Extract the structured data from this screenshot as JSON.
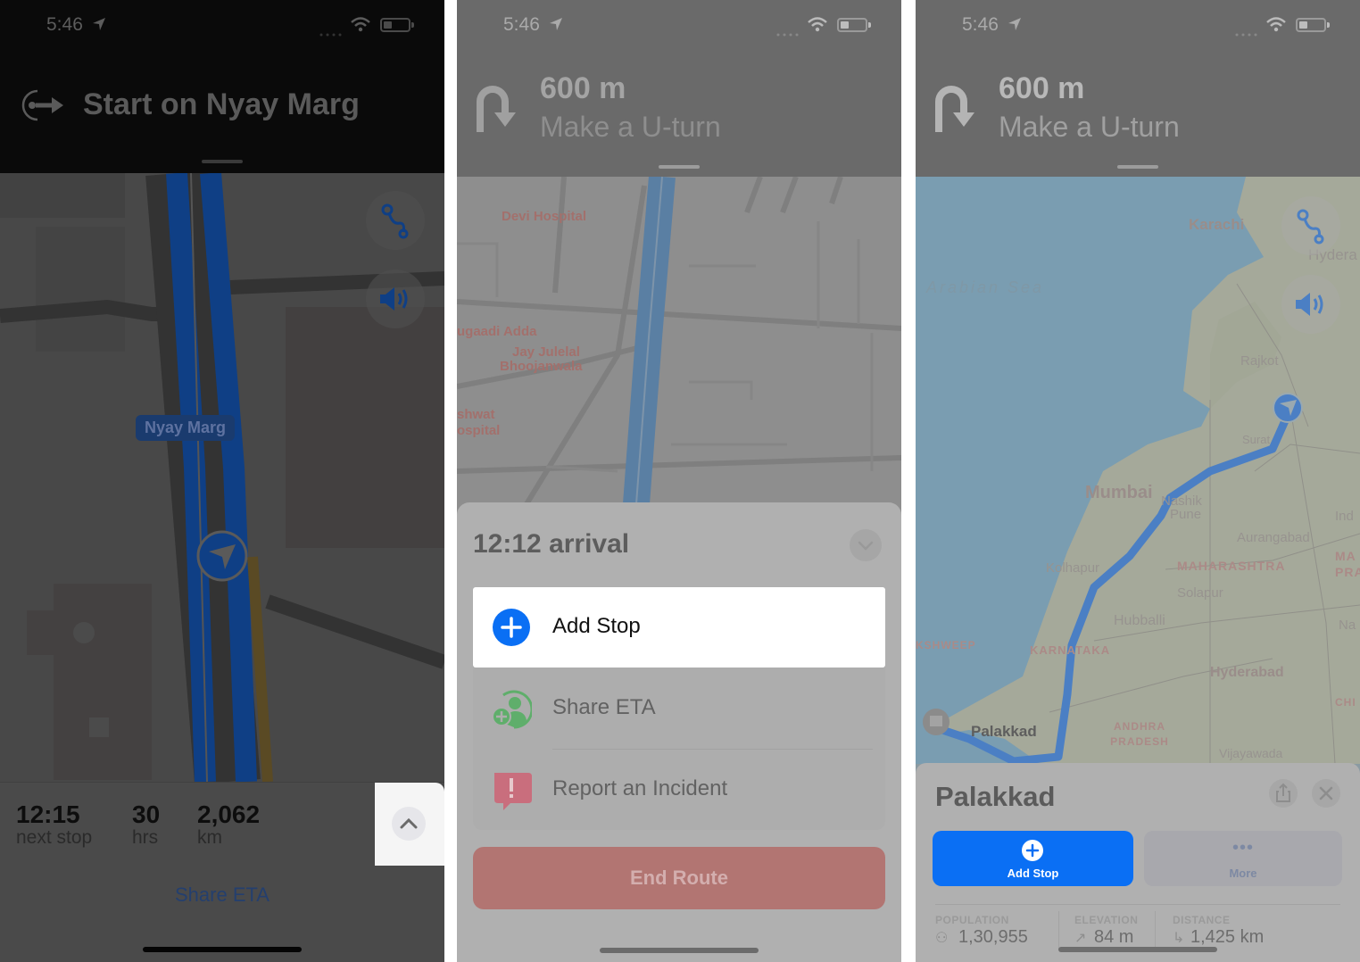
{
  "panels": [
    {
      "status_bar": {
        "time": "5:46"
      },
      "nav_banner": {
        "instruction": "Start on Nyay Marg",
        "icon": "start-route-icon"
      },
      "map": {
        "road_label": "Nyay Marg",
        "buttons": [
          {
            "icon": "route-options-icon"
          },
          {
            "icon": "speaker-volume-icon"
          }
        ]
      },
      "trip_bar": {
        "stats": [
          {
            "value": "12:15",
            "label": "next stop"
          },
          {
            "value": "30",
            "label": "hrs"
          },
          {
            "value": "2,062",
            "label": "km"
          }
        ],
        "expand_icon": "chevron-up-icon",
        "share_eta": "Share ETA"
      }
    },
    {
      "status_bar": {
        "time": "5:46"
      },
      "nav_banner": {
        "distance": "600 m",
        "instruction": "Make a U-turn",
        "icon": "u-turn-icon"
      },
      "map": {
        "pois": [
          "Devi Hospital",
          "ugaadi Adda",
          "Jay Julelal",
          "Bhoojanwala",
          "shwat",
          "ospital"
        ]
      },
      "sheet": {
        "arrival": "12:12 arrival",
        "collapse_icon": "chevron-down-icon",
        "menu": [
          {
            "label": "Add Stop",
            "icon": "add-stop-icon",
            "highlighted": true
          },
          {
            "label": "Share ETA",
            "icon": "share-eta-icon"
          },
          {
            "label": "Report an Incident",
            "icon": "report-incident-icon"
          }
        ],
        "end_route": "End Route"
      }
    },
    {
      "status_bar": {
        "time": "5:46"
      },
      "nav_banner": {
        "distance": "600 m",
        "instruction": "Make a U-turn",
        "icon": "u-turn-icon"
      },
      "map": {
        "labels": {
          "sea": "Arabian Sea",
          "karachi": "Karachi",
          "hyderabad_pk": "Hydera",
          "rajkot": "Rajkot",
          "surat": "Surat",
          "mumbai": "Mumbai",
          "nashik": "Nashik",
          "pune": "Pune",
          "aurangabad": "Aurangabad",
          "ind": "Ind",
          "maharashtra": "MAHARASHTRA",
          "ma_pra": "MA PRA",
          "kolhapur": "Kolhapur",
          "solapur": "Solapur",
          "hubballi": "Hubballi",
          "na": "Na",
          "lakshadweep": "KSHWEEP",
          "karnataka": "KARNATAKA",
          "hyderabad": "Hyderabad",
          "chh": "CHI",
          "andhra": "ANDHRA PRADESH",
          "palakkad": "Palakkad",
          "vijayawada": "Vijayawada"
        }
      },
      "place_card": {
        "title": "Palakkad",
        "add_stop": "Add Stop",
        "more": "More",
        "info": [
          {
            "header": "POPULATION",
            "value": "1,30,955",
            "icon": "people-icon"
          },
          {
            "header": "ELEVATION",
            "value": "84 m",
            "icon": "elevation-arrow-icon"
          },
          {
            "header": "DISTANCE",
            "value": "1,425 km",
            "icon": "route-distance-icon"
          }
        ]
      }
    }
  ],
  "colors": {
    "accent_blue": "#0a6ff4",
    "end_route_red": "#b27572",
    "share_eta_green": "#5fae6b",
    "incident_red": "#c96e7d"
  }
}
